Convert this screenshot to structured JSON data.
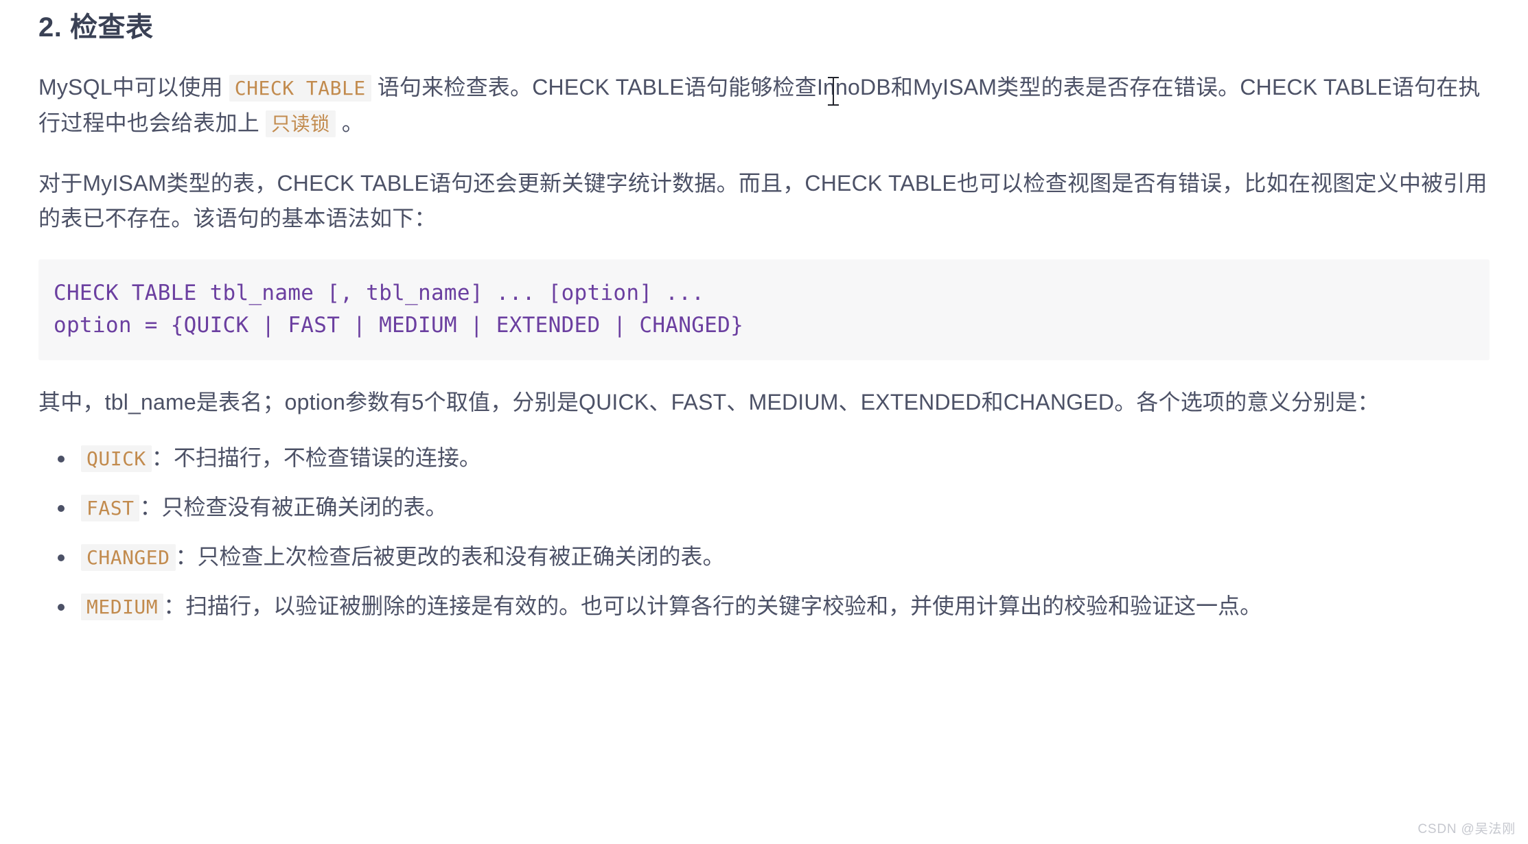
{
  "document": {
    "heading": "2. 检查表",
    "paragraph1": {
      "before_code": "MySQL中可以使用 ",
      "code1": "CHECK TABLE",
      "middle": " 语句来检查表。CHECK TABLE语句能够检查InnoDB和MyISAM类型的表是否存在错误。CHECK TABLE语句在执行过程中也会给表加上 ",
      "code2": "只读锁",
      "after": " 。"
    },
    "paragraph2": "对于MyISAM类型的表，CHECK TABLE语句还会更新关键字统计数据。而且，CHECK TABLE也可以检查视图是否有错误，比如在视图定义中被引用的表已不存在。该语句的基本语法如下：",
    "code_block": {
      "line1": "CHECK TABLE tbl_name [, tbl_name] ... [option] ...",
      "line2": "option = {QUICK | FAST | MEDIUM | EXTENDED | CHANGED}"
    },
    "paragraph3": "其中，tbl_name是表名；option参数有5个取值，分别是QUICK、FAST、MEDIUM、EXTENDED和CHANGED。各个选项的意义分别是：",
    "options": [
      {
        "code": "QUICK",
        "separator": "：",
        "text": "不扫描行，不检查错误的连接。"
      },
      {
        "code": "FAST",
        "separator": "：",
        "text": "只检查没有被正确关闭的表。"
      },
      {
        "code": "CHANGED",
        "separator": "：",
        "text": "只检查上次检查后被更改的表和没有被正确关闭的表。"
      },
      {
        "code": "MEDIUM",
        "separator": "：",
        "text": "扫描行，以验证被删除的连接是有效的。也可以计算各行的关键字校验和，并使用计算出的校验和验证这一点。"
      }
    ],
    "watermark": "CSDN @吴法刚"
  },
  "colors": {
    "body_text": "#4c5166",
    "heading": "#3a4155",
    "inline_code_text": "#c28b4e",
    "inline_code_bg": "#f4f4f4",
    "code_block_text": "#6b3fa0",
    "code_block_bg": "#f7f7f8",
    "watermark": "#c6c8cf",
    "page_bg": "#ffffff"
  }
}
